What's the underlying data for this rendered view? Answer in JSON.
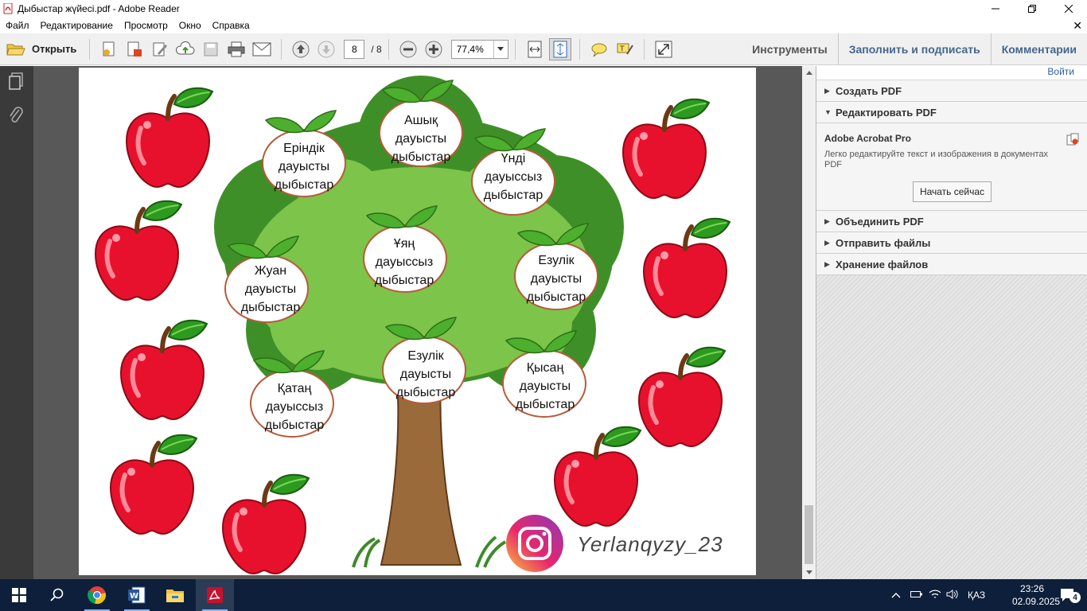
{
  "window": {
    "title": "Дыбыстар жүйесі.pdf - Adobe Reader"
  },
  "menu": {
    "items": [
      "Файл",
      "Редактирование",
      "Просмотр",
      "Окно",
      "Справка"
    ]
  },
  "toolbar": {
    "open_label": "Открыть",
    "page_current": "8",
    "page_total": "/ 8",
    "zoom_value": "77,4%",
    "tabs": [
      "Инструменты",
      "Заполнить и подписать",
      "Комментарии"
    ]
  },
  "document": {
    "leaves": [
      {
        "lines": [
          "Еріндік",
          "дауысты",
          "дыбыстар"
        ]
      },
      {
        "lines": [
          "Ашық",
          "дауысты",
          "дыбыстар"
        ]
      },
      {
        "lines": [
          "Үнді",
          "дауыссыз",
          "дыбыстар"
        ]
      },
      {
        "lines": [
          "Ұяң",
          "дауыссыз",
          "дыбыстар"
        ]
      },
      {
        "lines": [
          "Жуан",
          "дауысты",
          "дыбыстар"
        ]
      },
      {
        "lines": [
          "Езулік",
          "дауысты",
          "дыбыстар"
        ]
      },
      {
        "lines": [
          "Езулік",
          "дауысты",
          "дыбыстар"
        ]
      },
      {
        "lines": [
          "Қысаң",
          "дауысты",
          "дыбыстар"
        ]
      },
      {
        "lines": [
          "Қатаң",
          "дауыссыз",
          "дыбыстар"
        ]
      }
    ],
    "watermark": "Yerlanqyzy_23"
  },
  "right_panel": {
    "login": "Войти",
    "sections": [
      {
        "label": "Создать PDF",
        "expanded": false
      },
      {
        "label": "Редактировать PDF",
        "expanded": true
      }
    ],
    "edit_body": {
      "product": "Adobe Acrobat Pro",
      "description": "Легко редактируйте текст и изображения в документах PDF",
      "button": "Начать сейчас"
    },
    "more_sections": [
      {
        "label": "Объединить PDF"
      },
      {
        "label": "Отправить файлы"
      },
      {
        "label": "Хранение файлов"
      }
    ]
  },
  "taskbar": {
    "language": "ҚАЗ",
    "time": "23:26",
    "date": "02.09.2025",
    "notifications": "4"
  },
  "colors": {
    "toolbar_bg": "#f0f0f0",
    "doc_bg": "#585858",
    "left_nav_bg": "#3a3a3a",
    "taskbar_bg": "#0d1f3a",
    "tab_blue": "#44678f",
    "apple_red": "#e8112d",
    "tree_green": "#4caf2e"
  }
}
